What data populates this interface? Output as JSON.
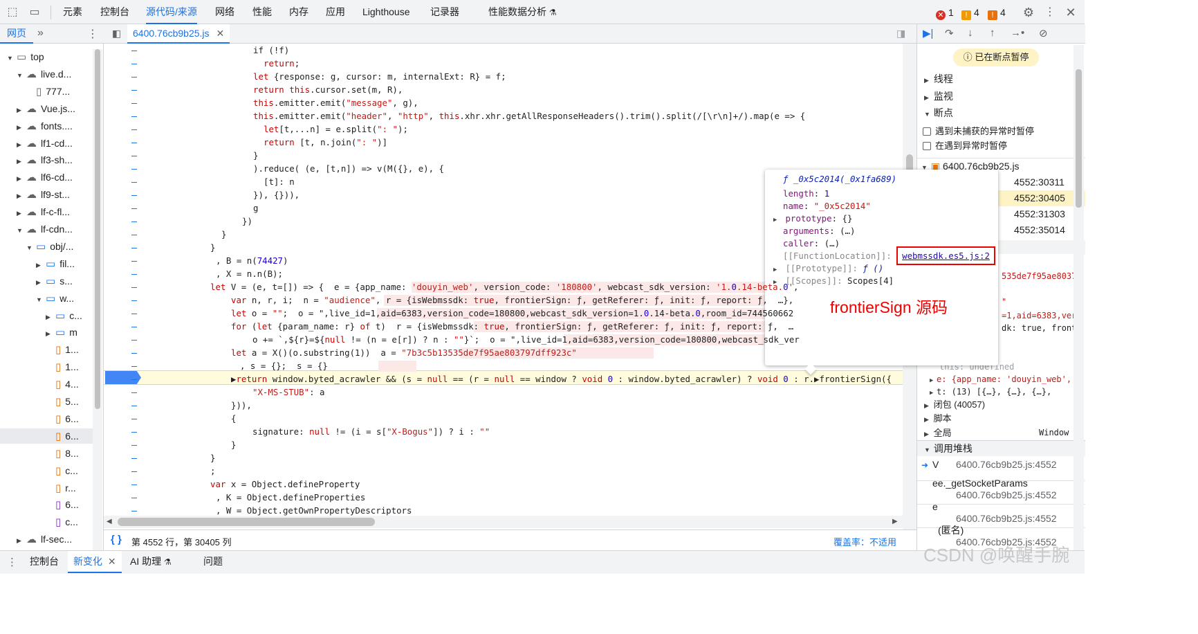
{
  "toolbar": {
    "tabs": [
      "元素",
      "控制台",
      "源代码/来源",
      "网络",
      "性能",
      "内存",
      "应用",
      "Lighthouse",
      "记录器",
      "性能数据分析"
    ],
    "errors": "1",
    "warnings": "4",
    "issues": "4"
  },
  "left_panel": {
    "tab_page": "网页",
    "tree": [
      {
        "label": "top",
        "level": 0,
        "icon": "frame"
      },
      {
        "label": "live.d...",
        "level": 1,
        "icon": "cloud"
      },
      {
        "label": "777...",
        "level": 2,
        "icon": "file"
      },
      {
        "label": "Vue.js...",
        "level": 1,
        "icon": "cloud"
      },
      {
        "label": "fonts....",
        "level": 1,
        "icon": "cloud"
      },
      {
        "label": "lf1-cd...",
        "level": 1,
        "icon": "cloud"
      },
      {
        "label": "lf3-sh...",
        "level": 1,
        "icon": "cloud"
      },
      {
        "label": "lf6-cd...",
        "level": 1,
        "icon": "cloud"
      },
      {
        "label": "lf9-st...",
        "level": 1,
        "icon": "cloud"
      },
      {
        "label": "lf-c-fl...",
        "level": 1,
        "icon": "cloud"
      },
      {
        "label": "lf-cdn...",
        "level": 1,
        "icon": "cloud"
      },
      {
        "label": "obj/...",
        "level": 2,
        "icon": "folder"
      },
      {
        "label": "fil...",
        "level": 3,
        "icon": "folder"
      },
      {
        "label": "s...",
        "level": 3,
        "icon": "folder"
      },
      {
        "label": "w...",
        "level": 3,
        "icon": "folder"
      },
      {
        "label": "c...",
        "level": 4,
        "icon": "folder"
      },
      {
        "label": "m",
        "level": 4,
        "icon": "folder"
      },
      {
        "label": "1...",
        "level": 4,
        "icon": "js"
      },
      {
        "label": "1...",
        "level": 4,
        "icon": "js"
      },
      {
        "label": "4...",
        "level": 4,
        "icon": "js"
      },
      {
        "label": "5...",
        "level": 4,
        "icon": "js"
      },
      {
        "label": "6...",
        "level": 4,
        "icon": "js"
      },
      {
        "label": "6...",
        "level": 4,
        "icon": "js"
      },
      {
        "label": "8...",
        "level": 4,
        "icon": "js"
      },
      {
        "label": "c...",
        "level": 4,
        "icon": "js"
      },
      {
        "label": "r...",
        "level": 4,
        "icon": "js"
      },
      {
        "label": "6...",
        "level": 4,
        "icon": "css"
      },
      {
        "label": "c...",
        "level": 4,
        "icon": "css"
      },
      {
        "label": "lf-sec...",
        "level": 1,
        "icon": "cloud"
      }
    ]
  },
  "editor": {
    "file_tab": "6400.76cb9b25.js",
    "status_position": "第 4552 行，第 30405 列",
    "coverage_label": "覆盖率：",
    "coverage_value": "不适用"
  },
  "popup": {
    "title": "ƒ _0x5c2014(_0x1fa689)",
    "length": "1",
    "name": "\"_0x5c2014\"",
    "prototype": "{}",
    "arguments": "(…)",
    "caller": "(…)",
    "function_location_key": "[[FunctionLocation]]:",
    "function_location": "webmssdk.es5.js:2",
    "prototype2_key": "[[Prototype]]:",
    "prototype2_value": "ƒ ()",
    "scopes_key": "[[Scopes]]:",
    "scopes_value": "Scopes[4]",
    "annotation": "frontierSign 源码"
  },
  "right_panel": {
    "paused_label": "已在断点暂停",
    "threads": "线程",
    "watch": "监视",
    "breakpoints": "断点",
    "pause_uncaught": "遇到未捕获的异常时暂停",
    "pause_caught": "在遇到异常时暂停",
    "bp_file": "6400.76cb9b25.js",
    "bp_lines": [
      "4552:30311",
      "4552:30405",
      "4552:31303",
      "4552:35014"
    ],
    "scope_peek": [
      "535de7f95ae8037",
      "\"",
      "=1,aid=6383,ver",
      "dk: true, front"
    ],
    "this_label": "this: undefined",
    "scope_e": "e: {app_name: 'douyin_web',",
    "scope_t": "t: (13) [{…}, {…}, {…},",
    "closure": "闭包 (40057)",
    "script": "脚本",
    "global": "全局",
    "global_value": "Window",
    "call_stack": "调用堆栈",
    "frames": [
      {
        "name": "V",
        "loc": "6400.76cb9b25.js:4552"
      },
      {
        "name": "ee._getSocketParams",
        "loc": "6400.76cb9b25.js:4552"
      },
      {
        "name": "e",
        "loc": "6400.76cb9b25.js:4552"
      },
      {
        "name": "(匿名)",
        "loc": "6400.76cb9b25.js:4552"
      }
    ]
  },
  "drawer": {
    "tabs": [
      "控制台",
      "新变化",
      "AI 助理",
      "问题"
    ]
  },
  "watermark": "CSDN @唤醒手腕"
}
